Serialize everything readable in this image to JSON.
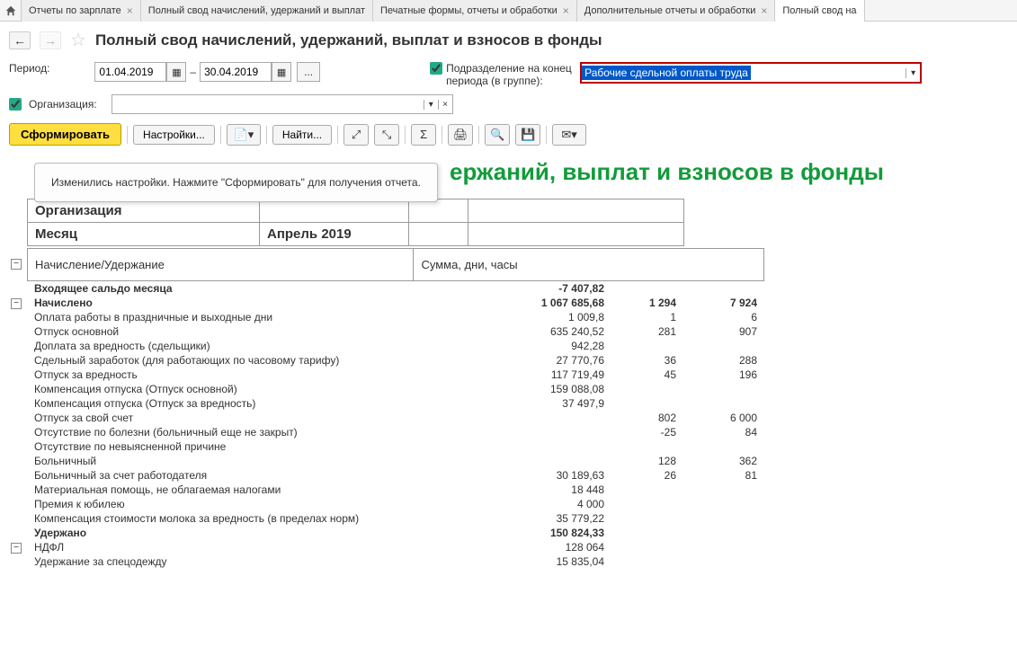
{
  "tabs": [
    {
      "label": "Отчеты по зарплате"
    },
    {
      "label": "Полный свод начислений, удержаний и выплат"
    },
    {
      "label": "Печатные формы, отчеты и обработки"
    },
    {
      "label": "Дополнительные отчеты и обработки"
    },
    {
      "label": "Полный свод на"
    }
  ],
  "page": {
    "title": "Полный свод начислений, удержаний, выплат и взносов в фонды"
  },
  "filters": {
    "period_label": "Период:",
    "date_from": "01.04.2019",
    "date_to": "30.04.2019",
    "dept_label": "Подразделение на конец периода (в группе):",
    "dept_value": "Рабочие сдельной оплаты труда",
    "org_label": "Организация:"
  },
  "toolbar": {
    "form_label": "Сформировать",
    "settings_label": "Настройки...",
    "find_label": "Найти..."
  },
  "tooltip": "Изменились настройки. Нажмите \"Сформировать\" для получения отчета.",
  "report": {
    "title_suffix": "ержаний, выплат и взносов в фонды",
    "org_label": "Организация",
    "month_label": "Месяц",
    "month_value": "Апрель 2019",
    "col1": "Начисление/Удержание",
    "col2": "Сумма, дни, часы",
    "rows": [
      {
        "label": "Входящее сальдо месяца",
        "sum": "-7 407,82",
        "c2": "",
        "c3": "",
        "bold": true
      },
      {
        "label": "Начислено",
        "sum": "1 067 685,68",
        "c2": "1 294",
        "c3": "7 924",
        "bold": true
      },
      {
        "label": "Оплата работы в праздничные и выходные дни",
        "sum": "1 009,8",
        "c2": "1",
        "c3": "6"
      },
      {
        "label": "Отпуск основной",
        "sum": "635 240,52",
        "c2": "281",
        "c3": "907"
      },
      {
        "label": "Доплата за вредность (сдельщики)",
        "sum": "942,28",
        "c2": "",
        "c3": ""
      },
      {
        "label": "Сдельный заработок (для работающих по часовому тарифу)",
        "sum": "27 770,76",
        "c2": "36",
        "c3": "288"
      },
      {
        "label": "Отпуск за вредность",
        "sum": "117 719,49",
        "c2": "45",
        "c3": "196"
      },
      {
        "label": "Компенсация отпуска (Отпуск основной)",
        "sum": "159 088,08",
        "c2": "",
        "c3": ""
      },
      {
        "label": "Компенсация отпуска (Отпуск за вредность)",
        "sum": "37 497,9",
        "c2": "",
        "c3": ""
      },
      {
        "label": "Отпуск за свой счет",
        "sum": "",
        "c2": "802",
        "c3": "6 000"
      },
      {
        "label": "Отсутствие по болезни (больничный еще не закрыт)",
        "sum": "",
        "c2": "-25",
        "c3": "84"
      },
      {
        "label": "Отсутствие по невыясненной причине",
        "sum": "",
        "c2": "",
        "c3": ""
      },
      {
        "label": "Больничный",
        "sum": "",
        "c2": "128",
        "c3": "362"
      },
      {
        "label": "Больничный за счет работодателя",
        "sum": "30 189,63",
        "c2": "26",
        "c3": "81"
      },
      {
        "label": "Материальная помощь, не облагаемая налогами",
        "sum": "18 448",
        "c2": "",
        "c3": ""
      },
      {
        "label": "Премия к юбилею",
        "sum": "4 000",
        "c2": "",
        "c3": ""
      },
      {
        "label": "Компенсация стоимости молока за вредность (в пределах норм)",
        "sum": "35 779,22",
        "c2": "",
        "c3": ""
      },
      {
        "label": "Удержано",
        "sum": "150 824,33",
        "c2": "",
        "c3": "",
        "bold": true
      },
      {
        "label": "НДФЛ",
        "sum": "128 064",
        "c2": "",
        "c3": ""
      },
      {
        "label": "Удержание за спецодежду",
        "sum": "15 835,04",
        "c2": "",
        "c3": ""
      }
    ]
  }
}
